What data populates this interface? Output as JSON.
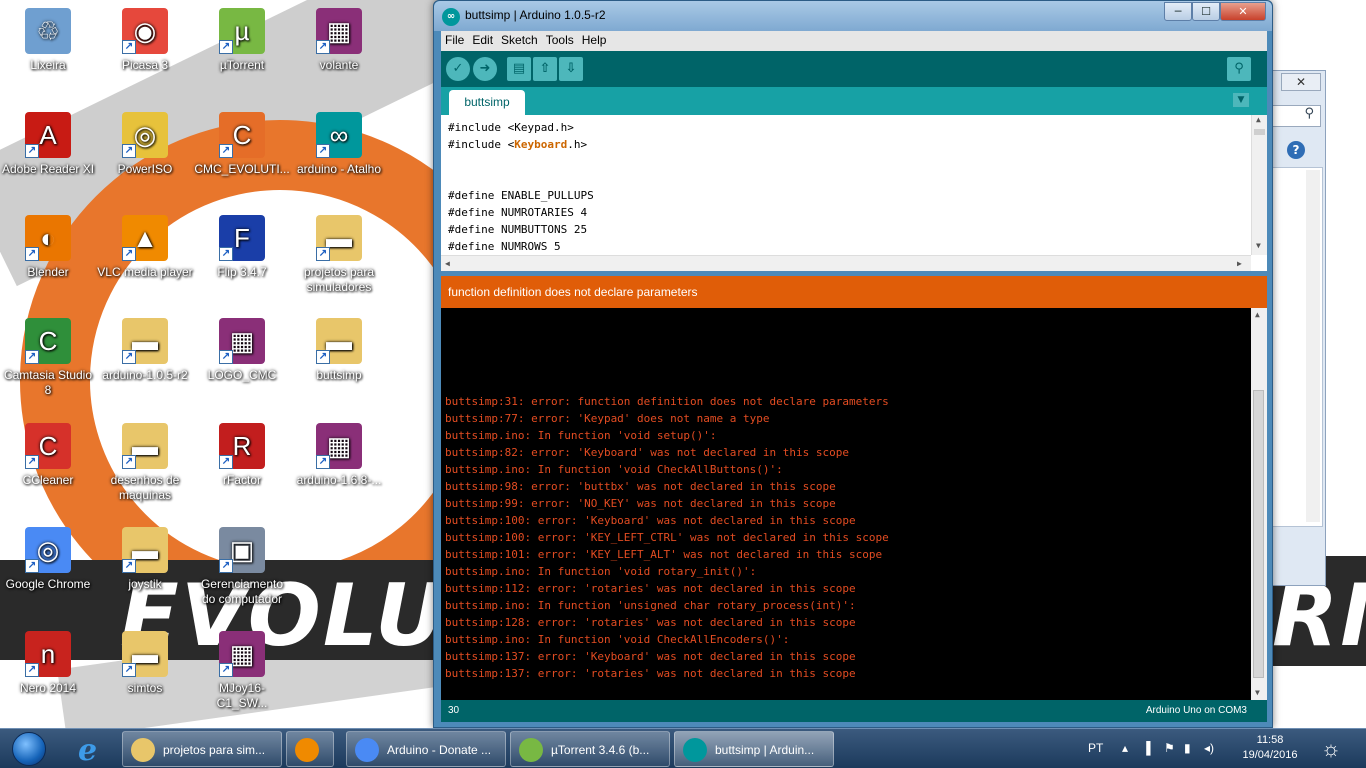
{
  "desktop": {
    "wallpaper_left_text": "EVOLUT",
    "wallpaper_right_text": "RM",
    "icons": [
      {
        "label": "Lixeira",
        "icon": "recycle-bin-icon",
        "color": "#6f9fd0",
        "glyph": "♲"
      },
      {
        "label": "Picasa 3",
        "icon": "picasa-icon",
        "color": "#e6483c",
        "glyph": "◉"
      },
      {
        "label": "µTorrent",
        "icon": "utorrent-icon",
        "color": "#78b843",
        "glyph": "µ"
      },
      {
        "label": "volante",
        "icon": "winrar-icon",
        "color": "#8a2f78",
        "glyph": "▦"
      },
      {
        "label": "Adobe Reader XI",
        "icon": "adobe-reader-icon",
        "color": "#c81b14",
        "glyph": "A"
      },
      {
        "label": "PowerISO",
        "icon": "poweriso-icon",
        "color": "#e7c23b",
        "glyph": "◎"
      },
      {
        "label": "CMC_EVOLUTI...",
        "icon": "cmc-icon",
        "color": "#e56d28",
        "glyph": "C"
      },
      {
        "label": "arduino - Atalho",
        "icon": "arduino-icon",
        "color": "#00979c",
        "glyph": "∞"
      },
      {
        "label": "Blender",
        "icon": "blender-icon",
        "color": "#ea7600",
        "glyph": "◐"
      },
      {
        "label": "VLC media player",
        "icon": "vlc-icon",
        "color": "#f08a00",
        "glyph": "▲"
      },
      {
        "label": "Flip 3.4.7",
        "icon": "atmel-flip-icon",
        "color": "#1a3ea8",
        "glyph": "F"
      },
      {
        "label": "projetos para simuladores",
        "icon": "folder-icon",
        "color": "#e8c66a",
        "glyph": "▬"
      },
      {
        "label": "Camtasia Studio 8",
        "icon": "camtasia-icon",
        "color": "#2f8f3a",
        "glyph": "C"
      },
      {
        "label": "arduino-1.0.5-r2",
        "icon": "folder-icon",
        "color": "#e8c66a",
        "glyph": "▬"
      },
      {
        "label": "LOGO_CMC",
        "icon": "winrar-icon",
        "color": "#8a2f78",
        "glyph": "▦"
      },
      {
        "label": "buttsimp",
        "icon": "folder-icon",
        "color": "#e8c66a",
        "glyph": "▬"
      },
      {
        "label": "CCleaner",
        "icon": "ccleaner-icon",
        "color": "#d6312a",
        "glyph": "C"
      },
      {
        "label": "desenhos de maquinas",
        "icon": "folder-icon",
        "color": "#e8c66a",
        "glyph": "▬"
      },
      {
        "label": "rFactor",
        "icon": "rfactor-icon",
        "color": "#c21e1e",
        "glyph": "R"
      },
      {
        "label": "arduino-1.6.8-...",
        "icon": "winrar-icon",
        "color": "#8a2f78",
        "glyph": "▦"
      },
      {
        "label": "Google Chrome",
        "icon": "chrome-icon",
        "color": "#4a8af4",
        "glyph": "◎"
      },
      {
        "label": "joystik",
        "icon": "folder-icon",
        "color": "#e8c66a",
        "glyph": "▬"
      },
      {
        "label": "Gerenciamento do computador",
        "icon": "computer-management-icon",
        "color": "#7a8aa0",
        "glyph": "▣"
      },
      {
        "label": "Nero 2014",
        "icon": "nero-icon",
        "color": "#c8231e",
        "glyph": "n"
      },
      {
        "label": "simtos",
        "icon": "folder-icon",
        "color": "#e8c66a",
        "glyph": "▬"
      },
      {
        "label": "MJoy16-C1_SW...",
        "icon": "winrar-icon",
        "color": "#8a2f78",
        "glyph": "▦"
      }
    ]
  },
  "background_window": {
    "close_glyph": "✕",
    "search_glyph": "⚲",
    "help_glyph": "?"
  },
  "arduino": {
    "title": "buttsimp | Arduino 1.0.5-r2",
    "app_icon_glyph": "∞",
    "window_buttons": {
      "minimize": "─",
      "maximize": "☐",
      "close": "✕"
    },
    "menu": [
      "File",
      "Edit",
      "Sketch",
      "Tools",
      "Help"
    ],
    "toolbar": [
      {
        "name": "verify-button",
        "glyph": "✓",
        "shape": "round"
      },
      {
        "name": "upload-button",
        "glyph": "➜",
        "shape": "round"
      },
      {
        "name": "new-button",
        "glyph": "▤",
        "shape": "square"
      },
      {
        "name": "open-button",
        "glyph": "⇧",
        "shape": "square"
      },
      {
        "name": "save-button",
        "glyph": "⇩",
        "shape": "square"
      }
    ],
    "serial_monitor_glyph": "⚲",
    "tab": "buttsimp",
    "tab_menu_glyph": "▼",
    "code": [
      {
        "pre": "#include <Keypad.h>",
        "kw": "",
        "post": ""
      },
      {
        "pre": "#include <",
        "kw": "Keyboard",
        "post": ".h>"
      },
      {
        "pre": "",
        "kw": "",
        "post": ""
      },
      {
        "pre": "",
        "kw": "",
        "post": ""
      },
      {
        "pre": "#define ENABLE_PULLUPS",
        "kw": "",
        "post": ""
      },
      {
        "pre": "#define NUMROTARIES 4",
        "kw": "",
        "post": ""
      },
      {
        "pre": "#define NUMBUTTONS 25",
        "kw": "",
        "post": ""
      },
      {
        "pre": "#define NUMROWS 5",
        "kw": "",
        "post": ""
      }
    ],
    "error_status": "function definition does not declare parameters",
    "console": [
      "buttsimp:31: error: function definition does not declare parameters",
      "buttsimp:77: error: 'Keypad' does not name a type",
      "buttsimp.ino: In function 'void setup()':",
      "buttsimp:82: error: 'Keyboard' was not declared in this scope",
      "buttsimp.ino: In function 'void CheckAllButtons()':",
      "buttsimp:98: error: 'buttbx' was not declared in this scope",
      "buttsimp:99: error: 'NO_KEY' was not declared in this scope",
      "buttsimp:100: error: 'Keyboard' was not declared in this scope",
      "buttsimp:100: error: 'KEY_LEFT_CTRL' was not declared in this scope",
      "buttsimp:101: error: 'KEY_LEFT_ALT' was not declared in this scope",
      "buttsimp.ino: In function 'void rotary_init()':",
      "buttsimp:112: error: 'rotaries' was not declared in this scope",
      "buttsimp.ino: In function 'unsigned char rotary_process(int)':",
      "buttsimp:128: error: 'rotaries' was not declared in this scope",
      "buttsimp.ino: In function 'void CheckAllEncoders()':",
      "buttsimp:137: error: 'Keyboard' was not declared in this scope",
      "buttsimp:137: error: 'rotaries' was not declared in this scope"
    ],
    "footer_line": "30",
    "footer_board": "Arduino Uno on COM3"
  },
  "taskbar": {
    "tasks": [
      {
        "label": "projetos para sim...",
        "icon": "folder-icon",
        "color": "#e8c66a",
        "active": false
      },
      {
        "label": "",
        "icon": "media-player-icon",
        "color": "#f08a00",
        "active": false
      },
      {
        "label": "Arduino - Donate ...",
        "icon": "chrome-icon",
        "color": "#4a8af4",
        "active": false
      },
      {
        "label": "µTorrent 3.4.6  (b...",
        "icon": "utorrent-icon",
        "color": "#78b843",
        "active": false
      },
      {
        "label": "buttsimp | Arduin...",
        "icon": "arduino-icon",
        "color": "#00979c",
        "active": true
      }
    ],
    "language": "PT",
    "tray_icons": [
      "▴",
      "▐",
      "⚑",
      "▮",
      "◂)"
    ],
    "clock_time": "11:58",
    "clock_date": "19/04/2016",
    "show_desktop_glyph": "☼"
  },
  "colors": {
    "arduino_teal_dark": "#006468",
    "arduino_teal": "#17a1a5",
    "error_orange": "#e05d08",
    "console_error": "#e34c22"
  }
}
